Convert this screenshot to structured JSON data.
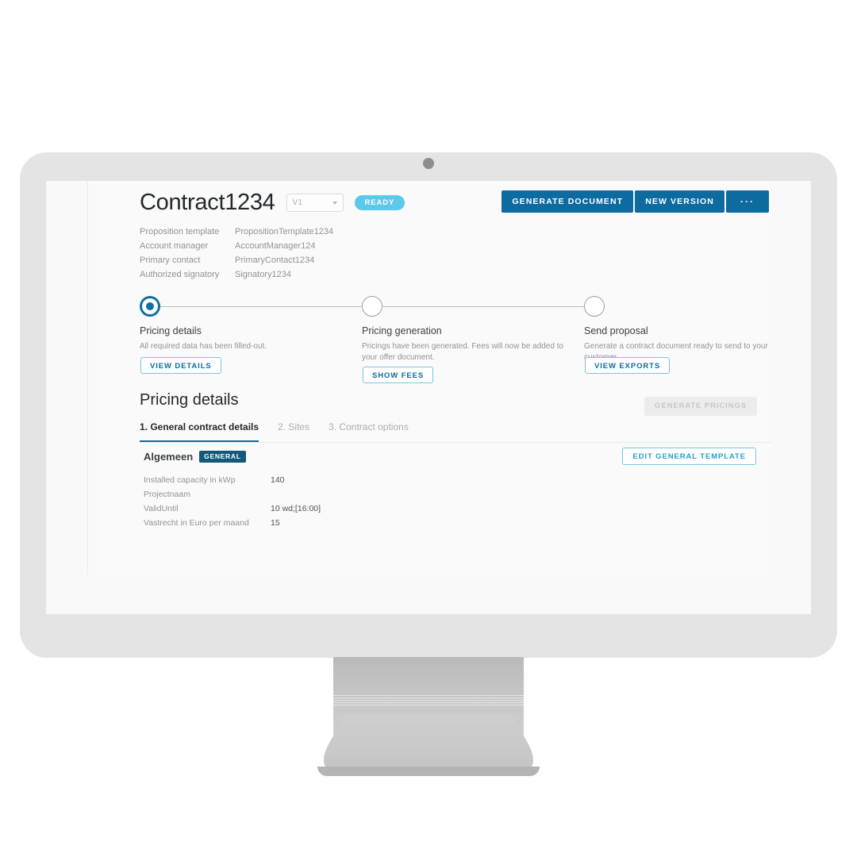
{
  "header": {
    "title": "Contract1234",
    "version_label": "V1",
    "status_badge": "READY",
    "actions": [
      {
        "label": "GENERATE DOCUMENT",
        "name": "generate-document-button"
      },
      {
        "label": "NEW VERSION",
        "name": "new-version-button"
      },
      {
        "label": "···",
        "name": "more-actions-button"
      }
    ]
  },
  "meta": [
    {
      "label": "Proposition template",
      "value": "PropositionTemplate1234"
    },
    {
      "label": "Account manager",
      "value": "AccountManager124"
    },
    {
      "label": "Primary contact",
      "value": "PrimaryContact1234"
    },
    {
      "label": "Authorized signatory",
      "value": "Signatory1234"
    }
  ],
  "stepper": [
    {
      "title": "Pricing details",
      "desc": "All required data has been filled-out.",
      "button": "VIEW DETAILS",
      "state": "active"
    },
    {
      "title": "Pricing generation",
      "desc": "Pricings have been generated. Fees will now be added to your offer document.",
      "button": "SHOW FEES",
      "state": "idle"
    },
    {
      "title": "Send proposal",
      "desc": "Generate a contract document ready to send to your customer.",
      "button": "VIEW EXPORTS",
      "state": "idle"
    }
  ],
  "section": {
    "title": "Pricing details",
    "generate_pricings_label": "GENERATE PRICINGS"
  },
  "tabs": [
    {
      "label": "1. General contract details",
      "active": true
    },
    {
      "label": "2. Sites",
      "active": false
    },
    {
      "label": "3. Contract options",
      "active": false
    }
  ],
  "card": {
    "title": "Algemeen",
    "tag": "GENERAL",
    "edit_button": "EDIT GENERAL TEMPLATE",
    "rows": [
      {
        "key": "Installed capacity in kWp",
        "value": "140"
      },
      {
        "key": "Projectnaam",
        "value": ""
      },
      {
        "key": "ValidUntil",
        "value": "10 wd;[16:00]"
      },
      {
        "key": "Vastrecht in Euro per maand",
        "value": "15"
      }
    ]
  },
  "colors": {
    "primary": "#0d6ba0",
    "tag_dark": "#13597a",
    "badge_cyan": "#5cc9ea",
    "outline_blue": "#79c5de",
    "monitor_shell": "#e4e4e4",
    "screen_bg": "#f9f9f9"
  }
}
